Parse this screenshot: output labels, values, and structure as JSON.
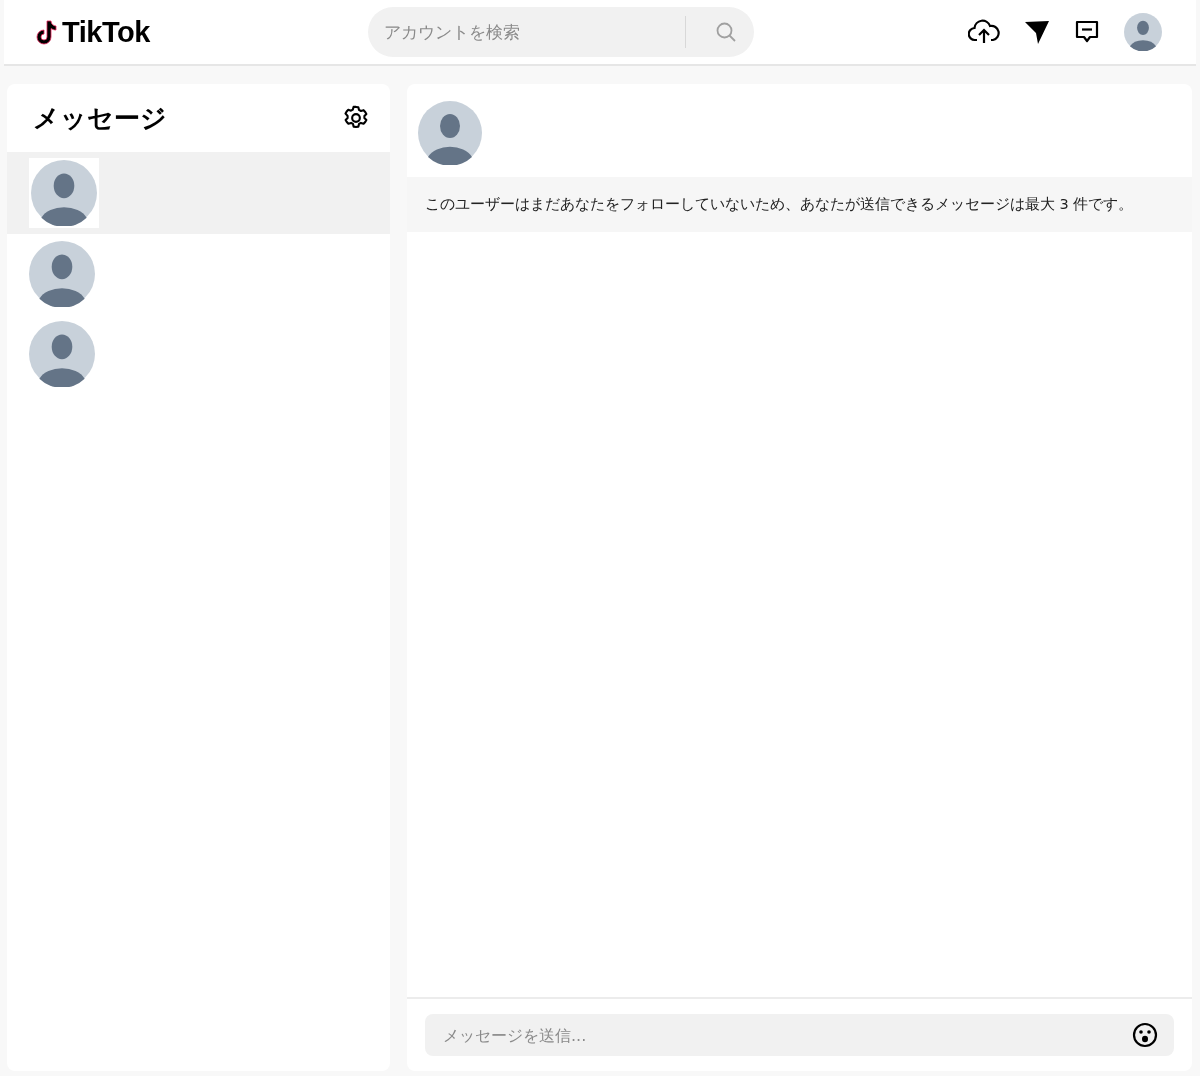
{
  "header": {
    "logo": "TikTok",
    "search": {
      "placeholder": "アカウントを検索"
    }
  },
  "sidebar": {
    "title": "メッセージ",
    "conversations": [
      {
        "selected": true
      },
      {
        "selected": false
      },
      {
        "selected": false
      }
    ]
  },
  "chat": {
    "notice": "このユーザーはまだあなたをフォローしていないため、あなたが送信できるメッセージは最大 3 件です。",
    "composer": {
      "placeholder": "メッセージを送信..."
    }
  }
}
